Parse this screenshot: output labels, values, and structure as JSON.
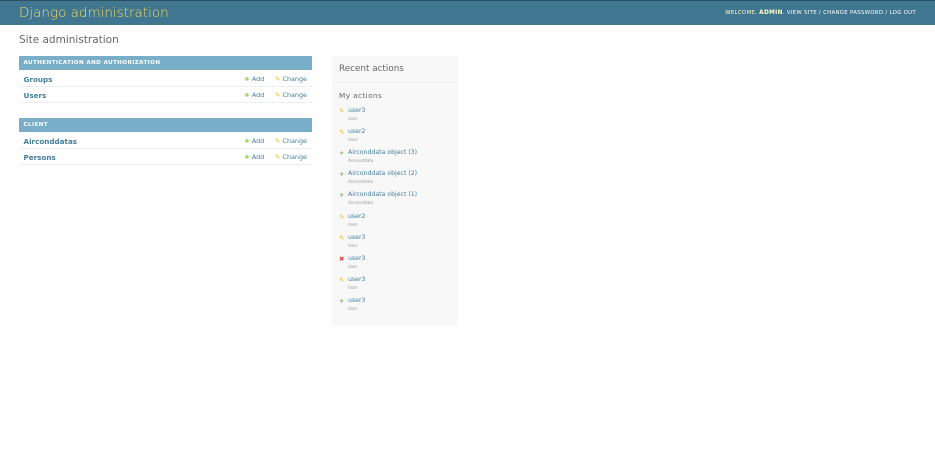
{
  "header": {
    "brand": "Django administration",
    "welcome": "WELCOME,",
    "username": "ADMIN",
    "links": [
      "VIEW SITE",
      "CHANGE PASSWORD",
      "LOG OUT"
    ]
  },
  "page_title": "Site administration",
  "apps": [
    {
      "caption": "AUTHENTICATION AND AUTHORIZATION",
      "models": [
        {
          "name": "Groups",
          "add": "Add",
          "change": "Change"
        },
        {
          "name": "Users",
          "add": "Add",
          "change": "Change"
        }
      ]
    },
    {
      "caption": "CLIENT",
      "models": [
        {
          "name": "Airconddatas",
          "add": "Add",
          "change": "Change"
        },
        {
          "name": "Persons",
          "add": "Add",
          "change": "Change"
        }
      ]
    }
  ],
  "recent_actions": {
    "title": "Recent actions",
    "subtitle": "My actions",
    "items": [
      {
        "icon": "pencil-icon",
        "label": "user3",
        "type": "User"
      },
      {
        "icon": "pencil-icon",
        "label": "user2",
        "type": "User"
      },
      {
        "icon": "plus-icon",
        "label": "Airconddata object (3)",
        "type": "Airconddata"
      },
      {
        "icon": "plus-icon",
        "label": "Airconddata object (2)",
        "type": "Airconddata"
      },
      {
        "icon": "plus-icon",
        "label": "Airconddata object (1)",
        "type": "Airconddata"
      },
      {
        "icon": "pencil-icon",
        "label": "user2",
        "type": "User"
      },
      {
        "icon": "pencil-icon",
        "label": "user3",
        "type": "User"
      },
      {
        "icon": "cross-icon",
        "label": "user3",
        "type": "User"
      },
      {
        "icon": "pencil-icon",
        "label": "user3",
        "type": "User"
      },
      {
        "icon": "plus-icon",
        "label": "user3",
        "type": "User"
      }
    ]
  },
  "colors": {
    "header_bg": "#417690",
    "brand": "#f5dd5d",
    "caption_bg": "#79aec8",
    "link": "#447e9b",
    "add_icon": "#70bf2b",
    "change_icon": "#efb80b",
    "delete_icon": "#dd4646"
  }
}
